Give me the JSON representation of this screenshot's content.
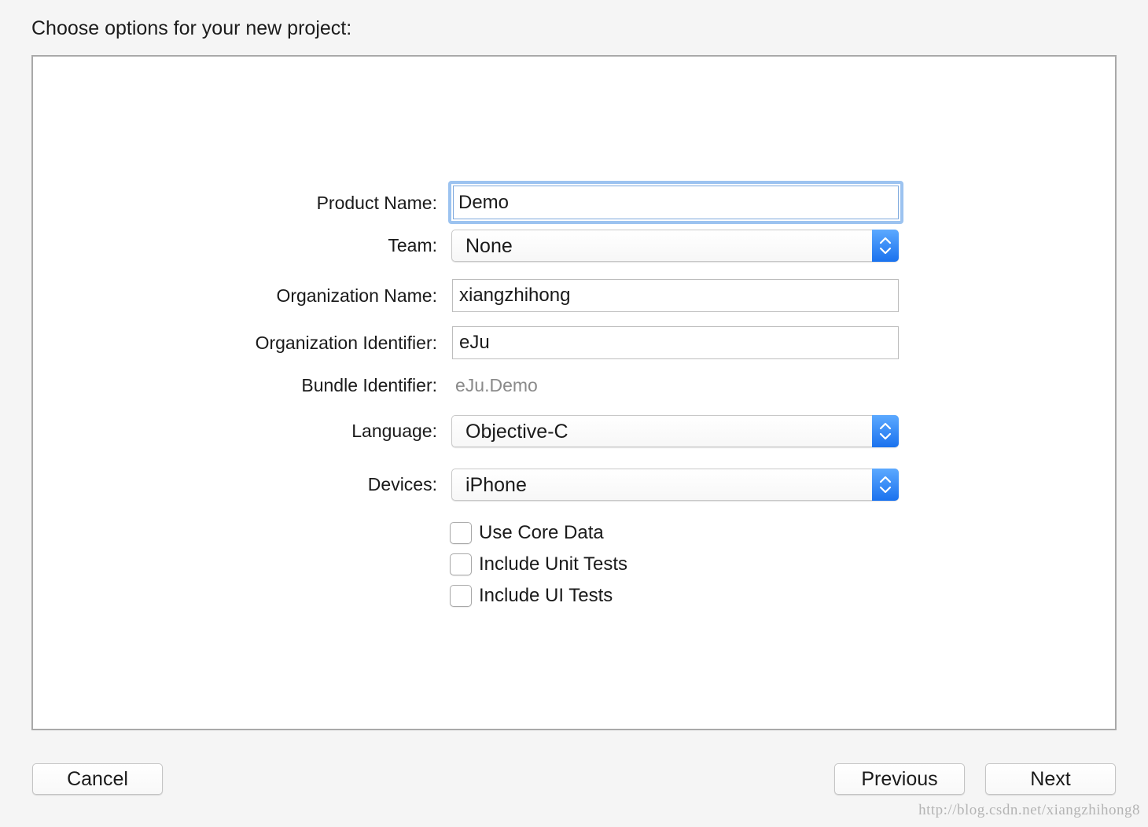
{
  "heading": "Choose options for your new project:",
  "form": {
    "product_name": {
      "label": "Product Name:",
      "value": "Demo"
    },
    "team": {
      "label": "Team:",
      "value": "None"
    },
    "organization_name": {
      "label": "Organization Name:",
      "value": "xiangzhihong"
    },
    "organization_identifier": {
      "label": "Organization Identifier:",
      "value": "eJu"
    },
    "bundle_identifier": {
      "label": "Bundle Identifier:",
      "value": "eJu.Demo"
    },
    "language": {
      "label": "Language:",
      "value": "Objective-C"
    },
    "devices": {
      "label": "Devices:",
      "value": "iPhone"
    },
    "checkboxes": [
      {
        "label": "Use Core Data",
        "checked": false
      },
      {
        "label": "Include Unit Tests",
        "checked": false
      },
      {
        "label": "Include UI Tests",
        "checked": false
      }
    ]
  },
  "buttons": {
    "cancel": "Cancel",
    "previous": "Previous",
    "next": "Next"
  },
  "watermark": "http://blog.csdn.net/xiangzhihong8",
  "colors": {
    "focus_ring": "#9cc3f0",
    "stepper_blue": "#1a72ee",
    "muted_text": "#8a8a8a"
  },
  "icons": {
    "popup_stepper": "up-down-chevron-icon"
  }
}
